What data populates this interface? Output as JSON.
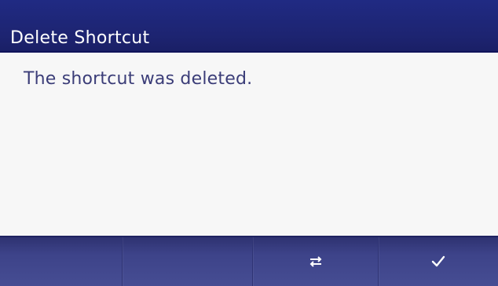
{
  "dialog": {
    "title": "Delete Shortcut",
    "message": "The shortcut was deleted."
  },
  "softkeys": [
    {
      "icon": "",
      "label": ""
    },
    {
      "icon": "",
      "label": ""
    },
    {
      "icon": "swap-icon",
      "label": ""
    },
    {
      "icon": "checkmark-icon",
      "label": ""
    }
  ],
  "colors": {
    "title_bar": "#1d2471",
    "title_text": "#ffffff",
    "message_text": "#3b3d78",
    "content_bg": "#f7f7f7",
    "softkey_bar": "#3d4389"
  }
}
